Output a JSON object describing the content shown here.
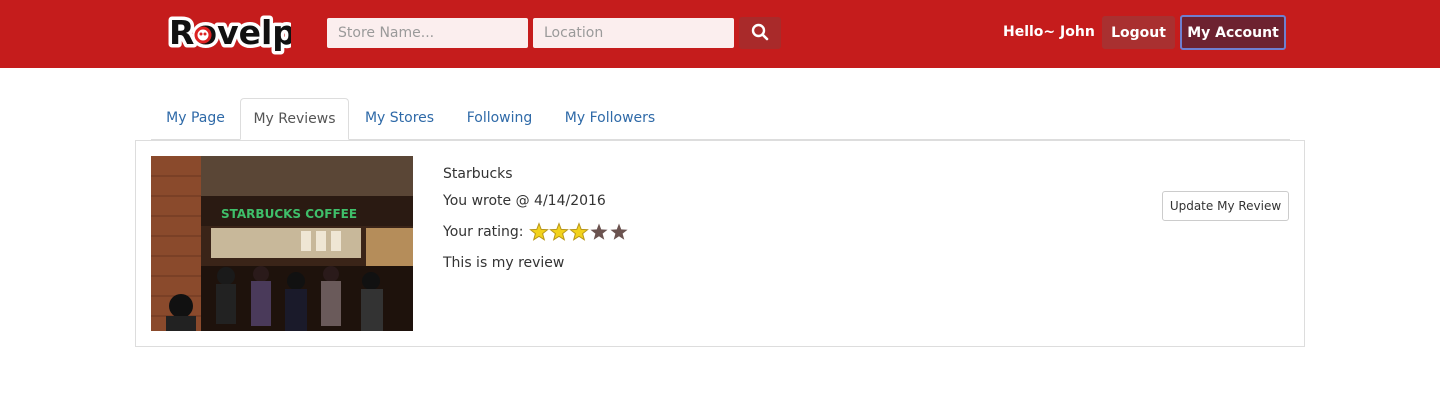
{
  "header": {
    "logo_text": "Rovelp",
    "search": {
      "store_placeholder": "Store Name...",
      "location_placeholder": "Location",
      "search_icon": "search-icon"
    },
    "greeting": "Hello~ John",
    "logout_label": "Logout",
    "account_label": "My Account",
    "colors": {
      "brand": "#c51c1c",
      "button": "#a93030",
      "account_button": "#6d2230"
    }
  },
  "tabs": [
    {
      "label": "My Page",
      "active": false
    },
    {
      "label": "My Reviews",
      "active": true
    },
    {
      "label": "My Stores",
      "active": false
    },
    {
      "label": "Following",
      "active": false
    },
    {
      "label": "My Followers",
      "active": false
    }
  ],
  "review": {
    "store_name": "Starbucks",
    "wrote": "You wrote @ 4/14/2016",
    "rating_label": "Your rating:",
    "rating": 3,
    "rating_max": 5,
    "text": "This is my review",
    "photo_sign": "STARBUCKS COFFEE",
    "update_label": "Update My Review"
  }
}
